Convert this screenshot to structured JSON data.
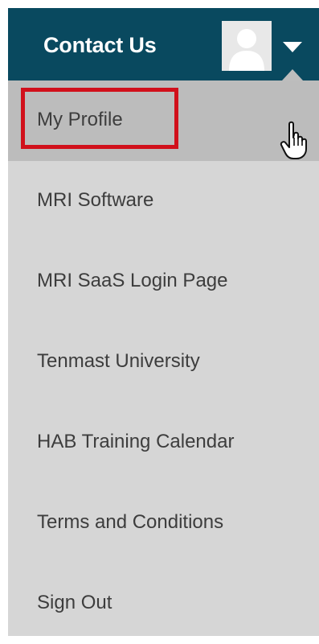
{
  "header": {
    "title": "Contact Us"
  },
  "user_menu": {
    "items": [
      {
        "label": "My Profile",
        "state": "hovered"
      },
      {
        "label": "MRI Software"
      },
      {
        "label": "MRI SaaS Login Page"
      },
      {
        "label": "Tenmast University"
      },
      {
        "label": "HAB Training Calendar"
      },
      {
        "label": "Terms and Conditions"
      },
      {
        "label": "Sign Out"
      }
    ]
  },
  "icons": {
    "avatar": "default-user-avatar-icon",
    "menu_toggle": "caret-down-icon",
    "cursor": "hand-pointer-cursor-icon"
  },
  "colors": {
    "header_bg": "#09495f",
    "menu_bg": "#d6d6d6",
    "hover_bg": "#bcbcbc",
    "highlight_border": "#d1101b",
    "menu_text": "#3d3d3d"
  }
}
